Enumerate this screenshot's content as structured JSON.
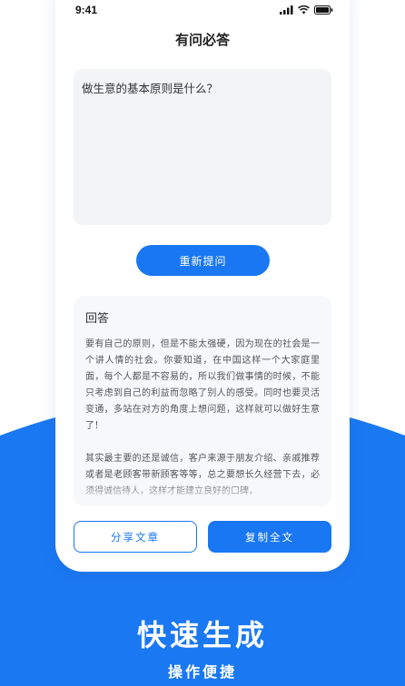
{
  "status_bar": {
    "time": "9:41"
  },
  "header": {
    "title": "有问必答"
  },
  "question": {
    "text": "做生意的基本原则是什么？"
  },
  "buttons": {
    "reask": "重新提问",
    "share": "分享文章",
    "copy": "复制全文"
  },
  "answer": {
    "title": "回答",
    "paragraphs": [
      "要有自己的原则，但是不能太强硬，因为现在的社会是一个讲人情的社会。你要知道，在中国这样一个大家庭里面，每个人都是不容易的，所以我们做事情的时候，不能只考虑到自己的利益而忽略了别人的感受。同时也要灵活变通，多站在对方的角度上想问题，这样就可以做好生意了！",
      "其实最主要的还是诚信，客户来源于朋友介绍、亲戚推荐或者是老顾客带新顾客等等，总之要想长久经营下去，必须得诚信待人，这样才能建立良好的口碑，"
    ]
  },
  "promo": {
    "title": "快速生成",
    "subtitle": "操作便捷"
  },
  "colors": {
    "primary": "#1977f3",
    "background_blue": "#1a78f2"
  },
  "icons": [
    "signal-icon",
    "wifi-icon",
    "battery-icon"
  ]
}
